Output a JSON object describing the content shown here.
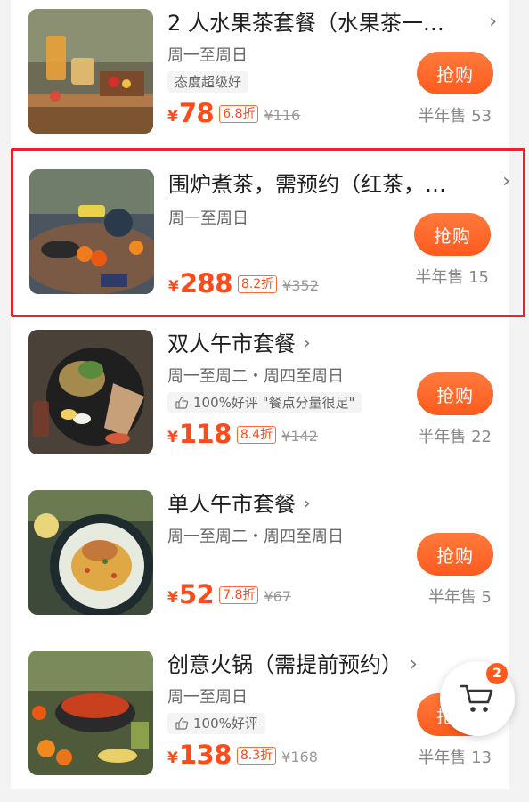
{
  "items": [
    {
      "title": "2 人水果茶套餐（水果茶一…",
      "schedule": "周一至周日",
      "tag": "态度超级好",
      "yen": "¥",
      "price": "78",
      "discount": "6.8折",
      "original": "¥116",
      "buy_label": "抢购",
      "sold": "半年售 53"
    },
    {
      "title": "围炉煮茶，需预约（红茶，…",
      "schedule": "周一至周日",
      "yen": "¥",
      "price": "288",
      "discount": "8.2折",
      "original": "¥352",
      "buy_label": "抢购",
      "sold": "半年售 15"
    },
    {
      "title": "双人午市套餐",
      "schedule": "周一至周二・周四至周日",
      "tag": "100%好评 \"餐点分量很足\"",
      "yen": "¥",
      "price": "118",
      "discount": "8.4折",
      "original": "¥142",
      "buy_label": "抢购",
      "sold": "半年售 22"
    },
    {
      "title": "单人午市套餐",
      "schedule": "周一至周二・周四至周日",
      "yen": "¥",
      "price": "52",
      "discount": "7.8折",
      "original": "¥67",
      "buy_label": "抢购",
      "sold": "半年售 5"
    },
    {
      "title": "创意火锅（需提前预约）",
      "schedule": "周一至周日",
      "tag": "100%好评",
      "yen": "¥",
      "price": "138",
      "discount": "8.3折",
      "original": "¥168",
      "buy_label": "抢购",
      "sold": "半年售 13"
    }
  ],
  "cart": {
    "count": "2",
    "icon": "cart-icon"
  },
  "colors": {
    "accent": "#ff5a1e",
    "price": "#ff4a1a",
    "highlight": "#e8232a"
  }
}
